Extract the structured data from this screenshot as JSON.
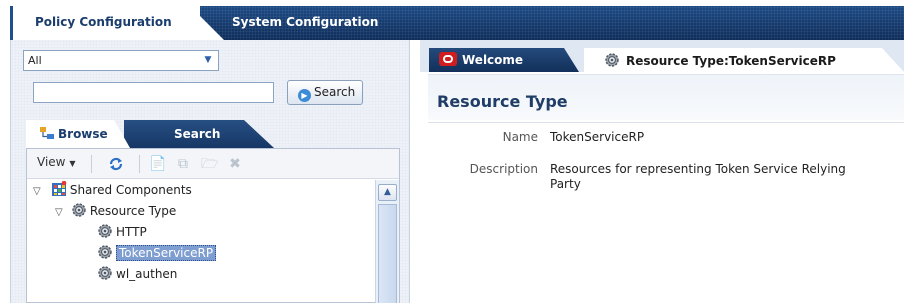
{
  "top_tabs": [
    {
      "label": "Policy Configuration",
      "active": true
    },
    {
      "label": "System Configuration",
      "active": false
    }
  ],
  "scope_select": {
    "value": "All"
  },
  "search": {
    "value": "",
    "button_label": "Search"
  },
  "nav_tabs": [
    {
      "label": "Browse",
      "active": true
    },
    {
      "label": "Search",
      "active": false
    }
  ],
  "toolbar": {
    "view_label": "View"
  },
  "tree": [
    {
      "label": "Shared Components",
      "expanded": true,
      "icon": "grid-icon"
    },
    {
      "label": "Resource Type",
      "expanded": true,
      "icon": "gear-icon"
    },
    {
      "label": "HTTP",
      "icon": "gear-icon"
    },
    {
      "label": "TokenServiceRP",
      "icon": "gear-icon",
      "selected": true
    },
    {
      "label": "wl_authen",
      "icon": "gear-icon"
    }
  ],
  "content_tabs": [
    {
      "label": "Welcome",
      "icon": "oracle-icon",
      "active": false
    },
    {
      "label": "Resource Type:TokenServiceRP",
      "icon": "gear-icon",
      "active": true
    }
  ],
  "detail": {
    "title": "Resource Type",
    "name_label": "Name",
    "name_value": "TokenServiceRP",
    "description_label": "Description",
    "description_value": "Resources for representing Token Service Relying Party"
  },
  "colors": {
    "accent_dark": "#163765",
    "title_text": "#1f3d66",
    "selection": "#7e9dd0"
  }
}
